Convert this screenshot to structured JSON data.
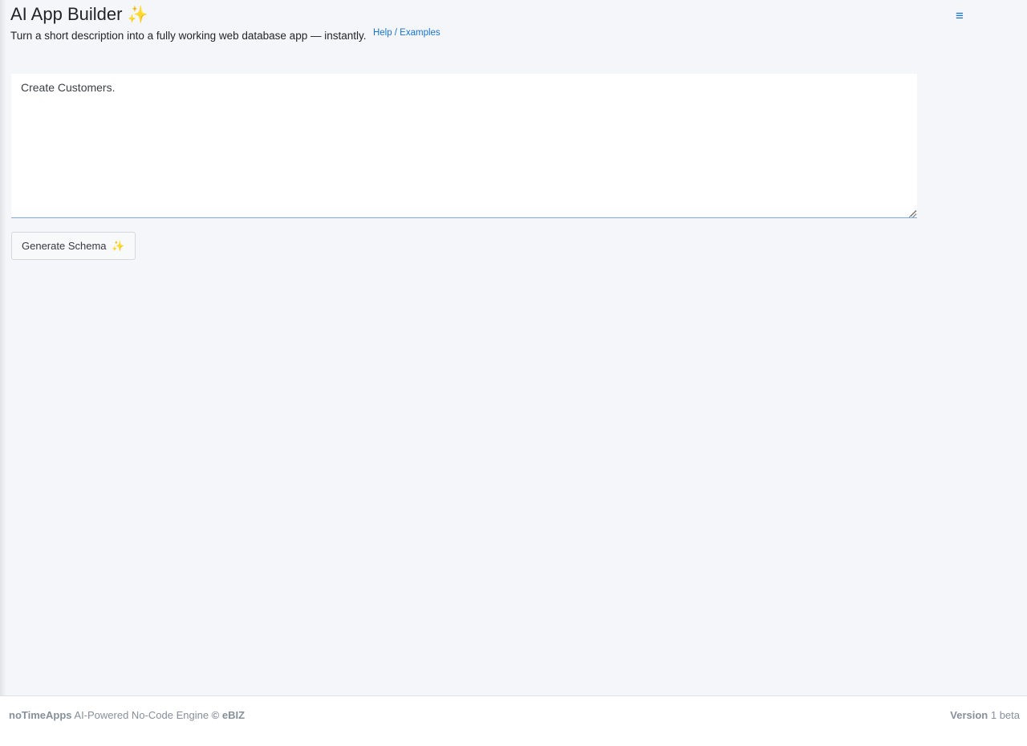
{
  "header": {
    "title": "AI App Builder",
    "title_icon": "✨",
    "subtitle": "Turn a short description into a fully working web database app — instantly.",
    "help_link": "Help / Examples",
    "menu_icon": "≡"
  },
  "prompt": {
    "value": "Create Customers."
  },
  "actions": {
    "generate_label": "Generate Schema",
    "generate_icon": "✨"
  },
  "footer": {
    "brand": "noTimeApps",
    "tagline": " AI-Powered No-Code Engine ",
    "copyright": "©",
    "company": "eBIZ",
    "version_label": "Version",
    "version_value": " 1 beta"
  },
  "colors": {
    "accent": "#1a73c9",
    "sparkle": "#f5b52a",
    "background": "#f4f6f9"
  }
}
